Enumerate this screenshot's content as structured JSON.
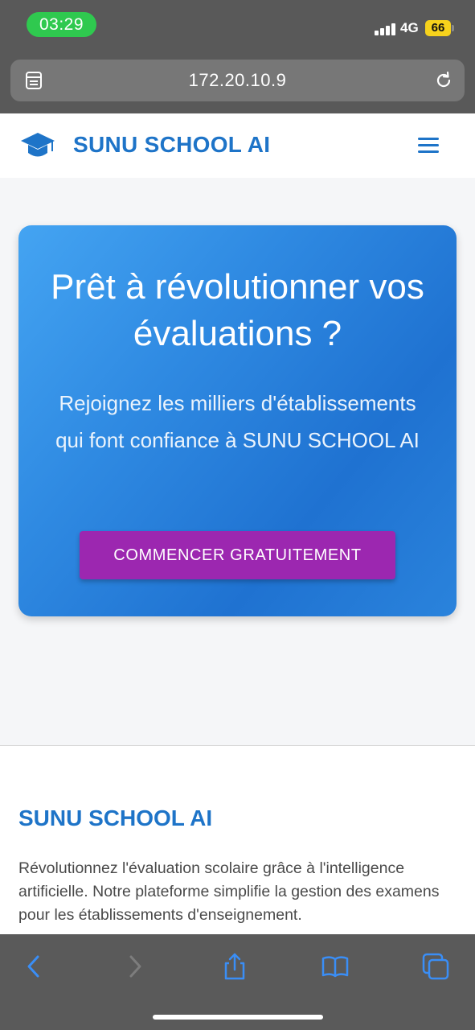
{
  "status_bar": {
    "time": "03:29",
    "network": "4G",
    "battery": "66"
  },
  "browser": {
    "url": "172.20.10.9"
  },
  "site": {
    "brand": "SUNU SCHOOL AI"
  },
  "hero": {
    "title": "Prêt à révolutionner vos évaluations ?",
    "subtitle": "Rejoignez les milliers d'établissements qui font confiance à SUNU SCHOOL AI",
    "cta_label": "COMMENCER GRATUITEMENT"
  },
  "footer": {
    "title": "SUNU SCHOOL AI",
    "description": "Révolutionnez l'évaluation scolaire grâce à l'intelligence artificielle. Notre plateforme simplifie la gestion des examens pour les établissements d'enseignement."
  },
  "icons": {
    "logo": "graduation-cap-icon",
    "menu": "hamburger-menu-icon",
    "tabs": "tab-overview-icon",
    "reload": "reload-icon",
    "back": "chevron-left-icon",
    "forward": "chevron-right-icon",
    "share": "share-icon",
    "bookmarks": "book-icon",
    "tabs_button": "tabs-icon"
  },
  "colors": {
    "brand": "#1e74c8",
    "cta": "#9c27b0",
    "status_time_pill": "#2fc94f",
    "battery": "#f6d21c",
    "ios_blue": "#3a8ef6"
  }
}
